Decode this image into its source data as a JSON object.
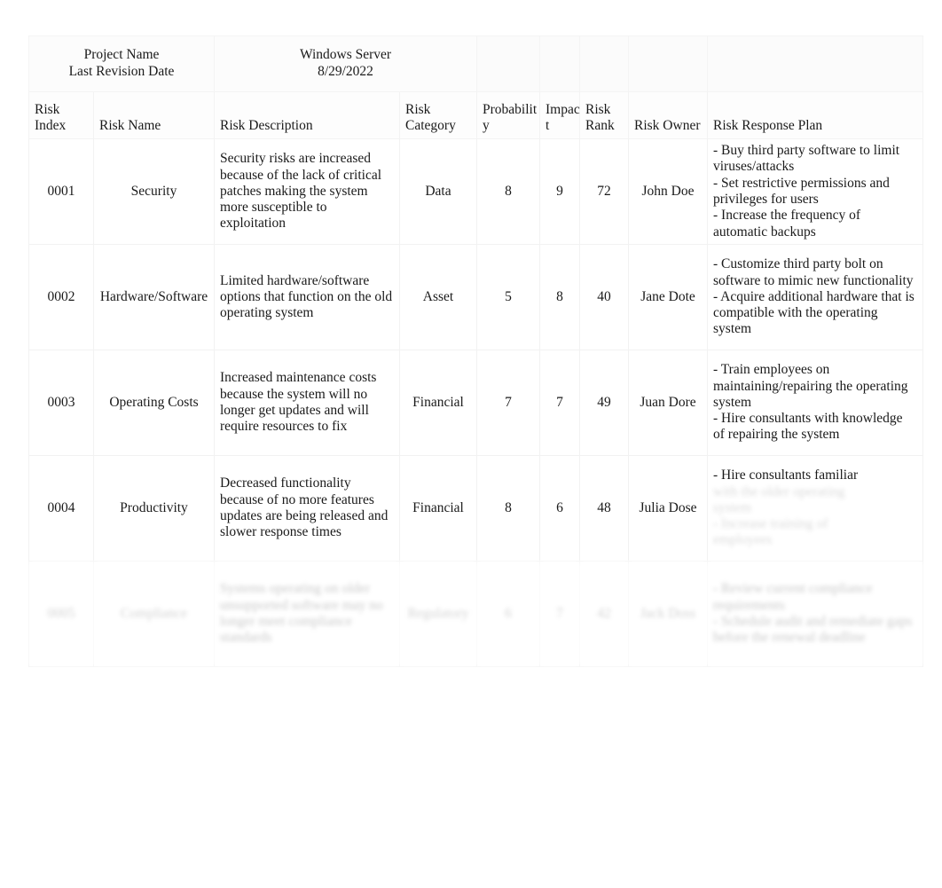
{
  "document": {
    "meta": {
      "project_name_label": "Project Name",
      "project_name_value": "Windows Server",
      "last_revision_label": "Last Revision Date",
      "last_revision_value": "8/29/2022"
    },
    "columns": {
      "risk_index": {
        "line1": "Risk",
        "line2": "Index"
      },
      "risk_name": {
        "line1": "",
        "line2": "Risk Name"
      },
      "risk_description": {
        "line1": "",
        "line2": "Risk Description"
      },
      "risk_category": {
        "line1": "Risk",
        "line2": "Category"
      },
      "probability": {
        "line1": "Probabilit",
        "line2": "y"
      },
      "impact": {
        "line1": "Impac",
        "line2": "t"
      },
      "risk_rank": {
        "line1": "Risk",
        "line2": "Rank"
      },
      "risk_owner": {
        "line1": "",
        "line2": "Risk Owner"
      },
      "risk_response_plan": {
        "line1": "",
        "line2": "Risk Response Plan"
      }
    },
    "rows": [
      {
        "index": "0001",
        "name": "Security",
        "description": "Security risks are increased because of the lack of critical patches making the system more susceptible to exploitation",
        "category": "Data",
        "probability": "8",
        "impact": "9",
        "rank": "72",
        "owner": "John Doe",
        "plan": [
          "- Buy third party software to limit viruses/attacks",
          "- Set restrictive permissions and privileges for users",
          "- Increase the frequency of automatic backups"
        ]
      },
      {
        "index": "0002",
        "name": "Hardware/Software",
        "description": "Limited hardware/software options that function on the old operating system",
        "category": "Asset",
        "probability": "5",
        "impact": "8",
        "rank": "40",
        "owner": "Jane Dote",
        "plan": [
          "- Customize third party bolt on software to mimic new functionality",
          "- Acquire additional hardware that is compatible with the operating system"
        ]
      },
      {
        "index": "0003",
        "name": "Operating Costs",
        "description": "Increased maintenance costs because the system will no longer get updates and will require resources to fix",
        "category": "Financial",
        "probability": "7",
        "impact": "7",
        "rank": "49",
        "owner": "Juan Dore",
        "plan": [
          "- Train employees on maintaining/repairing the operating system",
          "- Hire consultants with knowledge of repairing the system"
        ]
      },
      {
        "index": "0004",
        "name": "Productivity",
        "description": "Decreased functionality because of no more features updates are being released and slower response times",
        "category": "Financial",
        "probability": "8",
        "impact": "6",
        "rank": "48",
        "owner": "Julia Dose",
        "plan": [
          "- Hire consultants familiar"
        ],
        "plan_obscured": [
          "with the older operating",
          "system",
          "- Increase training of",
          "employees"
        ]
      },
      {
        "index": "0005",
        "name": "Compliance",
        "description": "Systems operating on older unsupported software may no longer meet compliance standards",
        "category": "Regulatory",
        "probability": "6",
        "impact": "7",
        "rank": "42",
        "owner": "Jack Doss",
        "plan": [
          "- Review current compliance requirements",
          "- Schedule audit and remediate gaps before the renewal deadline"
        ]
      }
    ]
  }
}
